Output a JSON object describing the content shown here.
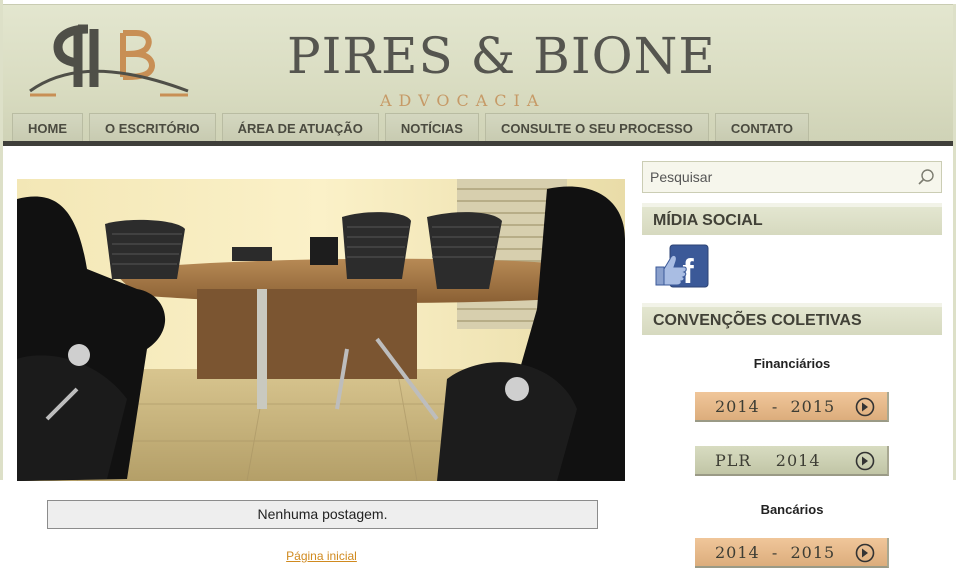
{
  "brand": {
    "name": "PIRES & BIONE",
    "subtitle": "ADVOCACIA",
    "logo_letters": "PB"
  },
  "nav": {
    "items": [
      {
        "label": "HOME"
      },
      {
        "label": "O ESCRITÓRIO"
      },
      {
        "label": "ÁREA DE ATUAÇÃO"
      },
      {
        "label": "NOTÍCIAS"
      },
      {
        "label": "CONSULTE O SEU PROCESSO"
      },
      {
        "label": "CONTATO"
      }
    ]
  },
  "main": {
    "no_posts": "Nenhuma postagem.",
    "home_link": "Página inicial"
  },
  "sidebar": {
    "search": {
      "placeholder": "Pesquisar",
      "icon": "search-icon"
    },
    "social": {
      "title": "MÍDIA SOCIAL",
      "icon": "facebook-like-icon"
    },
    "conventions": {
      "title": "CONVENÇÕES COLETIVAS",
      "financeiros_heading": "Financiários",
      "bancarios_heading": "Bancários",
      "buttons": [
        {
          "label": "2014  -  2015"
        },
        {
          "label": "PLR    2014"
        },
        {
          "label": "2014  -  2015"
        }
      ]
    }
  },
  "colors": {
    "header_bg": "#d9dcc1",
    "accent_orange": "#dcad7c",
    "accent_green": "#c1c5a6",
    "link": "#d08a1f"
  }
}
